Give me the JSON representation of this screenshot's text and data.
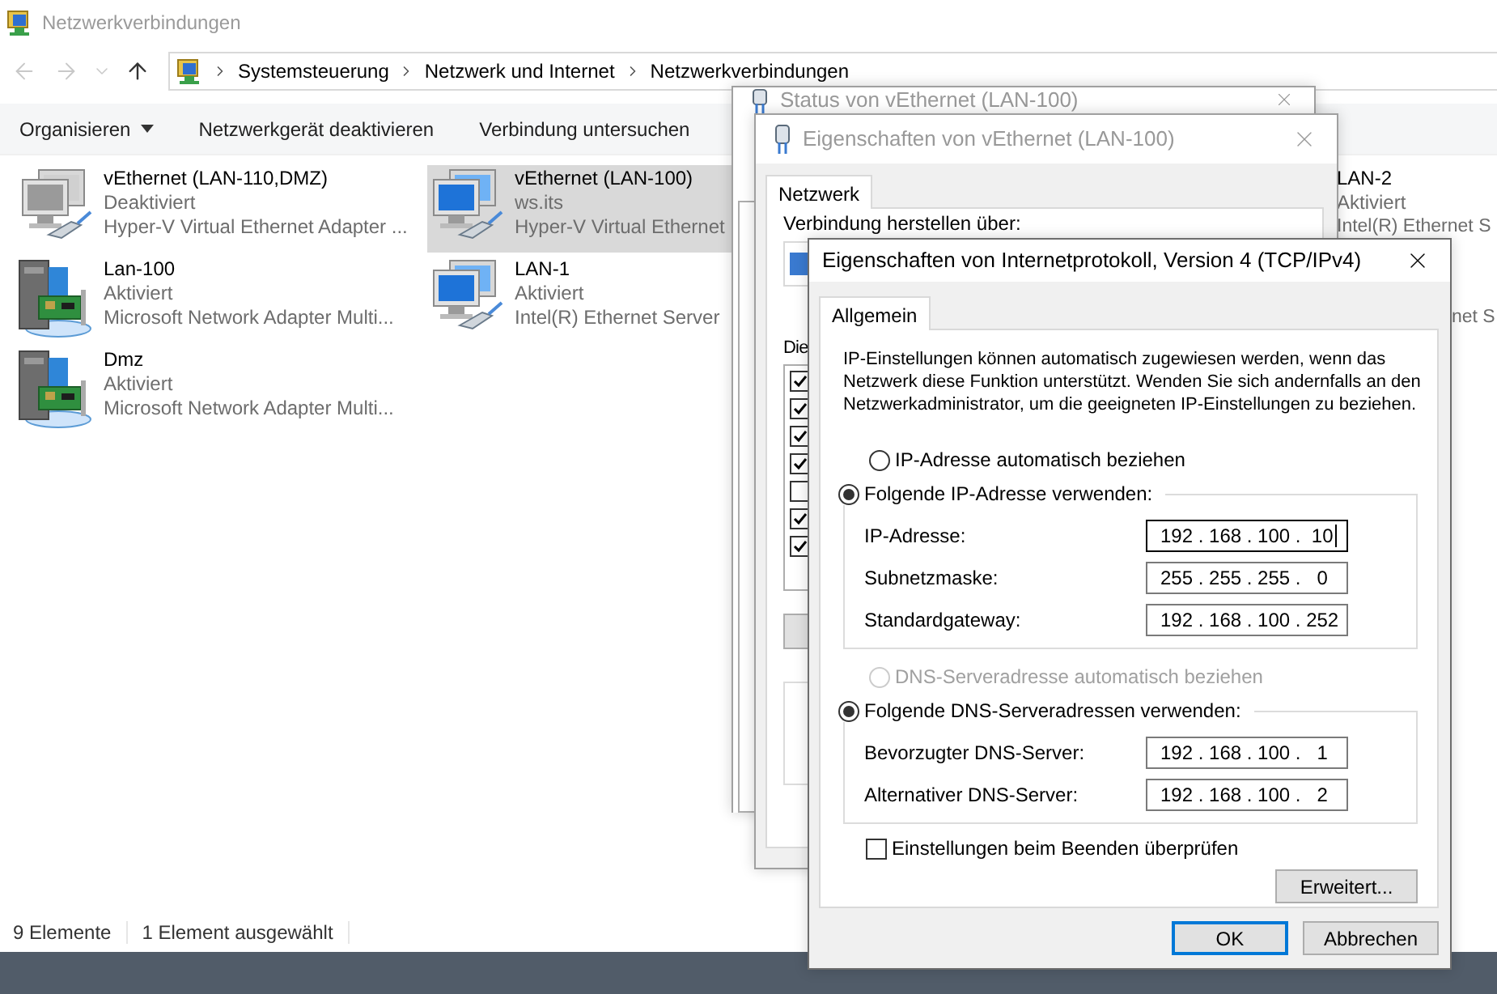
{
  "explorer": {
    "title": "Netzwerkverbindungen",
    "nav": {
      "back_enabled": false,
      "forward_enabled": false
    },
    "breadcrumbs": [
      "Systemsteuerung",
      "Netzwerk und Internet",
      "Netzwerkverbindungen"
    ],
    "commands": [
      {
        "label": "Organisieren",
        "dropdown": true
      },
      {
        "label": "Netzwerkgerät deaktivieren",
        "dropdown": false
      },
      {
        "label": "Verbindung untersuchen",
        "dropdown": false
      }
    ],
    "items": [
      {
        "name": "vEthernet (LAN-110,DMZ)",
        "status": "Deaktiviert",
        "detail": "Hyper-V Virtual Ethernet Adapter ...",
        "kind": "monitors",
        "disabled": true,
        "selected": false
      },
      {
        "name": "vEthernet (LAN-100)",
        "status": "ws.its",
        "detail": "Hyper-V Virtual Ethernet",
        "kind": "monitors",
        "disabled": false,
        "selected": true
      },
      {
        "name": "LAN-2",
        "status": "Aktiviert",
        "detail": "Intel(R) Ethernet S",
        "kind": "covered",
        "selected": false
      },
      {
        "name": "Lan-100",
        "status": "Aktiviert",
        "detail": "Microsoft Network Adapter Multi...",
        "kind": "server",
        "disabled": false,
        "selected": false
      },
      {
        "name": "LAN-1",
        "status": "Aktiviert",
        "detail": "Intel(R) Ethernet Server",
        "kind": "monitors",
        "disabled": false,
        "selected": false
      },
      {
        "detail": "net S",
        "kind": "fragment",
        "selected": false
      },
      {
        "name": "Dmz",
        "status": "Aktiviert",
        "detail": "Microsoft Network Adapter Multi...",
        "kind": "server",
        "disabled": false,
        "selected": false
      }
    ],
    "status_bar": [
      "9 Elemente",
      "1 Element ausgewählt"
    ]
  },
  "status_window": {
    "title": "Status von vEthernet (LAN-100)"
  },
  "properties_window": {
    "title": "Eigenschaften von vEthernet (LAN-100)",
    "tabs": [
      {
        "label": "Netzwerk",
        "selected": true
      }
    ],
    "connect_label": "Verbindung herstellen über:",
    "components_label": "Die",
    "components": [
      {
        "checked": true
      },
      {
        "checked": true
      },
      {
        "checked": true
      },
      {
        "checked": true
      },
      {
        "checked": false
      },
      {
        "checked": true
      },
      {
        "checked": true
      }
    ]
  },
  "ipv4_dialog": {
    "title": "Eigenschaften von Internetprotokoll, Version 4 (TCP/IPv4)",
    "tabs": [
      {
        "label": "Allgemein",
        "selected": true
      }
    ],
    "intro": "IP-Einstellungen können automatisch zugewiesen werden, wenn das Netzwerk diese Funktion unterstützt. Wenden Sie sich andernfalls an den Netzwerkadministrator, um die geeigneten IP-Einstellungen zu beziehen.",
    "options": [
      {
        "kind": "radio",
        "label": "IP-Adresse automatisch beziehen",
        "selected": false,
        "disabled": false
      },
      {
        "kind": "group",
        "label": "Folgende IP-Adresse verwenden:",
        "selected": true,
        "disabled": false,
        "fields": [
          {
            "label": "IP-Adresse:",
            "value": "192 . 168 . 100 .  10",
            "focused": true
          },
          {
            "label": "Subnetzmaske:",
            "value": "255 . 255 . 255 .   0",
            "focused": false
          },
          {
            "label": "Standardgateway:",
            "value": "192 . 168 . 100 . 252",
            "focused": false
          }
        ]
      },
      {
        "kind": "radio",
        "label": "DNS-Serveradresse automatisch beziehen",
        "selected": false,
        "disabled": true
      },
      {
        "kind": "group",
        "label": "Folgende DNS-Serveradressen verwenden:",
        "selected": true,
        "disabled": false,
        "fields": [
          {
            "label": "Bevorzugter DNS-Server:",
            "value": "192 . 168 . 100 .   1",
            "focused": false
          },
          {
            "label": "Alternativer DNS-Server:",
            "value": "192 . 168 . 100 .   2",
            "focused": false
          }
        ]
      }
    ],
    "validate": {
      "label": "Einstellungen beim Beenden überprüfen",
      "checked": false
    },
    "advanced_button": "Erweitert...",
    "buttons": [
      {
        "label": "OK",
        "default": true
      },
      {
        "label": "Abbrechen",
        "default": false
      }
    ]
  }
}
